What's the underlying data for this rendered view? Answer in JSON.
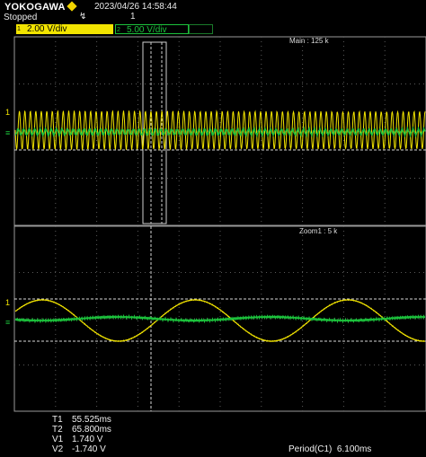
{
  "header": {
    "brand": "YOKOGAWA",
    "datetime": "2023/04/26  14:58:44",
    "status": "Stopped",
    "trigger_mode_icon": "trigger-edge-icon",
    "acquisition_count": "1"
  },
  "channels": [
    {
      "id": "1",
      "scale": "2.00 V/div",
      "color": "#f2e400"
    },
    {
      "id": "2",
      "scale": "5.00 V/div",
      "color": "#1cc23c"
    }
  ],
  "main_window": {
    "label": "Main : 125 k"
  },
  "zoom_window": {
    "label": "Zoom1 : 5 k"
  },
  "cursors": {
    "T1": "55.525ms",
    "T2": "65.800ms",
    "V1": "1.740 V",
    "V2": "-1.740 V"
  },
  "measurement": {
    "label": "Period(C1)",
    "value": "6.100ms"
  },
  "colors": {
    "ch1": "#f2e400",
    "ch2": "#1cc23c",
    "grid": "#5a5a5a",
    "frame": "#9a9a9a",
    "cursor": "#d8d8d8"
  }
}
